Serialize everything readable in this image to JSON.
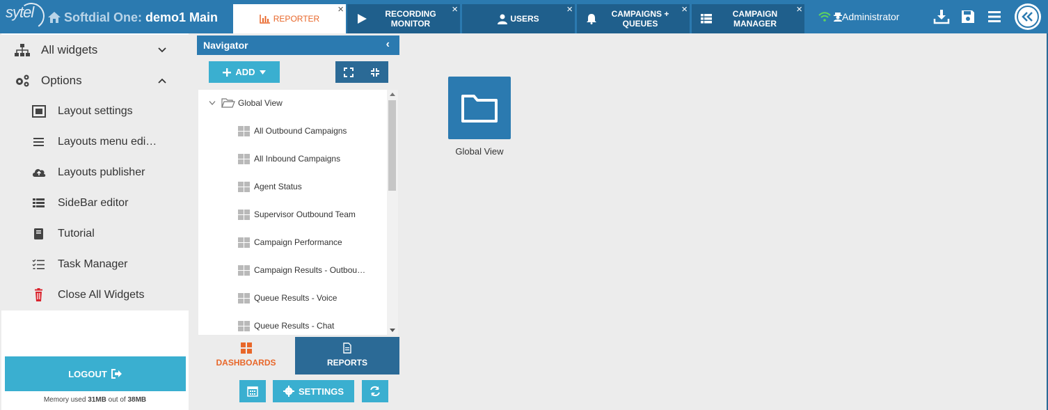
{
  "header": {
    "logo_text": "sytel",
    "app_name": "Softdial One:",
    "layout_name": "demo1 Main",
    "user": "Administrator",
    "tabs": [
      {
        "label_line1": "REPORTER",
        "label_line2": "",
        "active": true
      },
      {
        "label_line1": "RECORDING",
        "label_line2": "MONITOR",
        "active": false
      },
      {
        "label_line1": "USERS",
        "label_line2": "",
        "active": false
      },
      {
        "label_line1": "CAMPAIGNS +",
        "label_line2": "QUEUES",
        "active": false
      },
      {
        "label_line1": "CAMPAIGN",
        "label_line2": "MANAGER",
        "active": false
      }
    ],
    "close_glyph": "×"
  },
  "sidebar": {
    "all_widgets": "All widgets",
    "options": "Options",
    "items": [
      {
        "label": "Layout settings",
        "icon": "layout-icon"
      },
      {
        "label": "Layouts menu edi…",
        "icon": "list-icon"
      },
      {
        "label": "Layouts publisher",
        "icon": "cloud-upload-icon"
      },
      {
        "label": "SideBar editor",
        "icon": "table-icon"
      },
      {
        "label": "Tutorial",
        "icon": "book-icon"
      },
      {
        "label": "Task Manager",
        "icon": "task-list-icon"
      },
      {
        "label": "Close All Widgets",
        "icon": "trash-icon"
      }
    ],
    "logout": "LOGOUT",
    "memory_prefix": "Memory used",
    "memory_used": "31MB",
    "memory_mid": "out of",
    "memory_total": "38MB"
  },
  "navigator": {
    "title": "Navigator",
    "collapse_glyph": "‹",
    "add_label": "ADD",
    "tree_root": "Global View",
    "tree_items": [
      "All Outbound Campaigns",
      "All Inbound Campaigns",
      "Agent Status",
      "Supervisor Outbound Team",
      "Campaign Performance",
      "Campaign Results - Outbou…",
      "Queue Results - Voice",
      "Queue Results - Chat"
    ],
    "tab_dashboards": "DASHBOARDS",
    "tab_reports": "REPORTS",
    "settings_label": "SETTINGS"
  },
  "main": {
    "folder_label": "Global View"
  },
  "colors": {
    "primary": "#2b7ab0",
    "dark": "#1f5f8c",
    "accent": "#e8672a",
    "button": "#3aafd0",
    "danger": "#d9232d"
  }
}
